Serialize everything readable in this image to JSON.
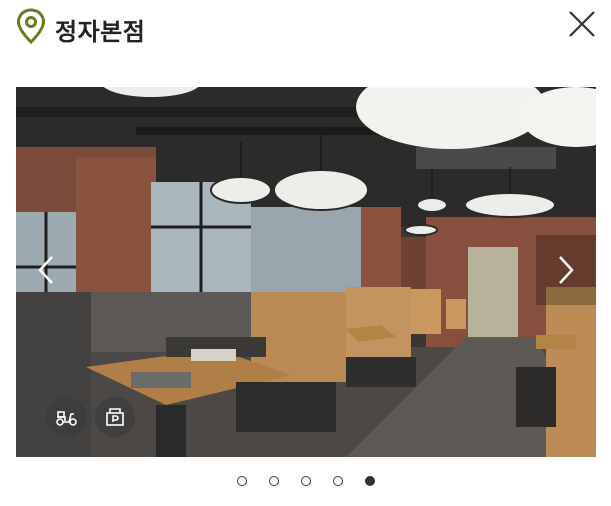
{
  "header": {
    "title": "정자본점"
  },
  "gallery": {
    "slide_count": 5,
    "active_index": 4
  },
  "badges": [
    {
      "icon": "delivery-scooter-icon"
    },
    {
      "icon": "parking-icon"
    }
  ],
  "colors": {
    "pin": "#6b7a1f",
    "title": "#222222",
    "dot": "#333333"
  }
}
